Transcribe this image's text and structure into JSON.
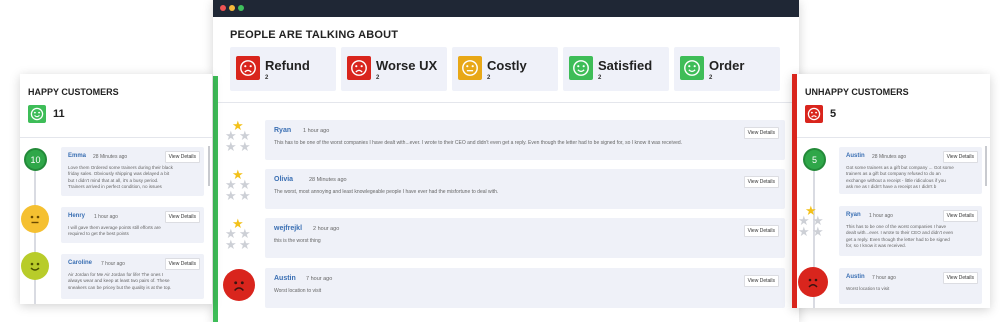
{
  "colors": {
    "red": "#d9251d",
    "green": "#3ebd58",
    "amber": "#e8a817",
    "link": "#3a6fb3",
    "card_bg": "#eff1f8"
  },
  "main": {
    "title": "PEOPLE ARE TALKING ABOUT",
    "topics": [
      {
        "label": "Refund",
        "count": "2",
        "sentiment": "negative",
        "icon": "sad-face-icon"
      },
      {
        "label": "Worse UX",
        "count": "2",
        "sentiment": "negative",
        "icon": "sad-face-icon"
      },
      {
        "label": "Costly",
        "count": "2",
        "sentiment": "neutral",
        "icon": "neutral-face-icon"
      },
      {
        "label": "Satisfied",
        "count": "2",
        "sentiment": "positive",
        "icon": "happy-face-icon"
      },
      {
        "label": "Order",
        "count": "2",
        "sentiment": "positive",
        "icon": "happy-face-icon"
      }
    ],
    "reviews": [
      {
        "name": "Ryan",
        "time": "1 hour ago",
        "text": "This has to be one of the worst companies I have dealt with...ever. I wrote to their CEO and didn't even get a reply. Even though the letter had to be signed for, so I know it was received.",
        "rating": 1,
        "action": "View Details"
      },
      {
        "name": "Olivia",
        "time": "28 Minutes ago",
        "text": "The worst, most annoying and least knowlegeable people I have ever had the misfortune to deal with.",
        "rating": 1,
        "action": "View Details"
      },
      {
        "name": "wejfrejkl",
        "time": "2 hour ago",
        "text": "this is the worst thing",
        "rating": 1,
        "action": "View Details"
      },
      {
        "name": "Austin",
        "time": "7 hour ago",
        "text": "Worst location to visit",
        "rating": null,
        "face": "sad-face-icon",
        "action": "View Details"
      }
    ]
  },
  "happy": {
    "title": "HAPPY CUSTOMERS",
    "count": "11",
    "reviews": [
      {
        "badge": "10",
        "name": "Emma",
        "time": "28 Minutes ago",
        "text": "Love them Ordered some trainers during their black friday sales. Obviously shipping was delayed a bit but I didn't mind that at all, it's a busy period. Trainers arrived in perfect condition, no issues",
        "action": "View Details"
      },
      {
        "face": "neutral-face-icon",
        "name": "Henry",
        "time": "1 hour ago",
        "text": "I will gave them average points still efforts are required to get the best points",
        "action": "View Details"
      },
      {
        "face": "happy-face-icon",
        "name": "Caroline",
        "time": "7 hour ago",
        "text": "Air Jordan for Me Air Jordan for life! The ones I always wear and keep at least two pairs of. These sneakers can be pricey but the quality is at the top.",
        "action": "View Details"
      }
    ]
  },
  "unhappy": {
    "title": "UNHAPPY CUSTOMERS",
    "count": "5",
    "reviews": [
      {
        "badge": "5",
        "name": "Austin",
        "time": "28 Minutes ago",
        "text": "Got some trainers as a gift but company ... Got some trainers as a gift but company refused to do an exchange without a receipt - little ridiculous if you ask me as I didn't have a receipt as I didn't b",
        "action": "View Details"
      },
      {
        "rating": 1,
        "name": "Ryan",
        "time": "1 hour ago",
        "text": "This has to be one of the worst companies I have dealt with...ever. I wrote to their CEO and didn't even get a reply. Even though the letter had to be signed for, so I know it was received.",
        "action": "View Details"
      },
      {
        "face": "sad-face-icon",
        "name": "Austin",
        "time": "7 hour ago",
        "text": "Worst location to visit",
        "action": "View Details"
      }
    ]
  }
}
